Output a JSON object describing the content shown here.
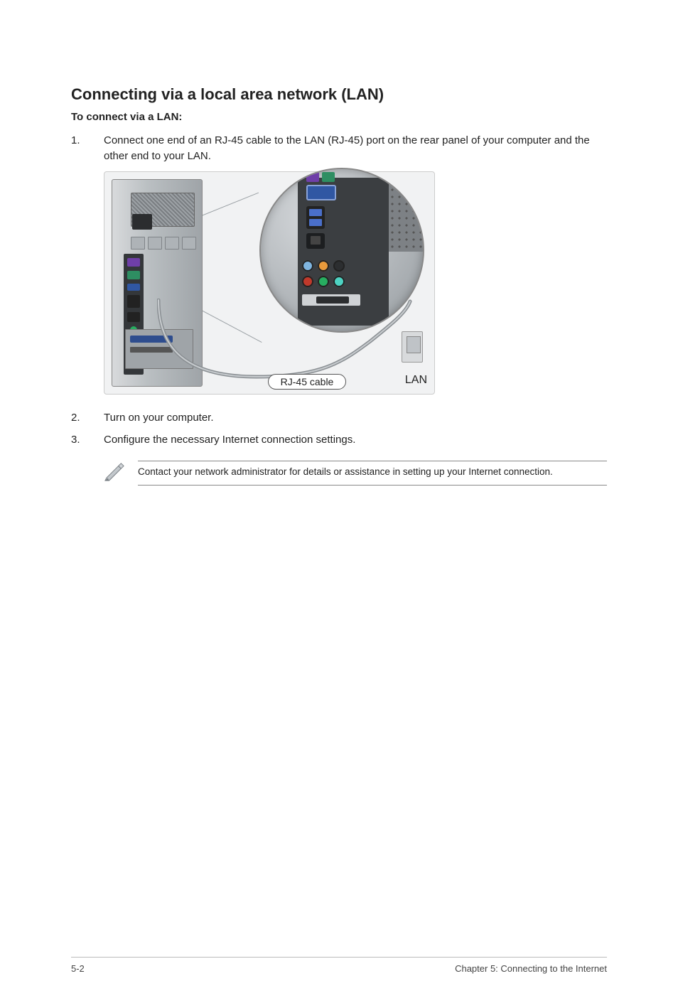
{
  "heading": "Connecting via a local area network (LAN)",
  "subheading": "To connect via a LAN:",
  "steps": [
    {
      "num": "1.",
      "text": "Connect one end of an RJ-45 cable to the LAN (RJ-45) port on the rear panel of your computer and the other end to your LAN."
    },
    {
      "num": "2.",
      "text": "Turn on your computer."
    },
    {
      "num": "3.",
      "text": "Configure the necessary Internet connection settings."
    }
  ],
  "figure": {
    "rj_label": "RJ-45 cable",
    "lan_label": "LAN",
    "colors": {
      "vga": "#3057a3",
      "ps2_purple": "#6f3fa8",
      "ps2_green": "#2e8e62",
      "audio": [
        "#7fb5e0",
        "#e99a3b",
        "#2c2e30",
        "#c0392b",
        "#27ae60",
        "#4dd2c2"
      ]
    }
  },
  "note": "Contact your network administrator for details or assistance in setting up your Internet connection.",
  "footer": {
    "left": "5-2",
    "right": "Chapter 5: Connecting to the Internet"
  }
}
